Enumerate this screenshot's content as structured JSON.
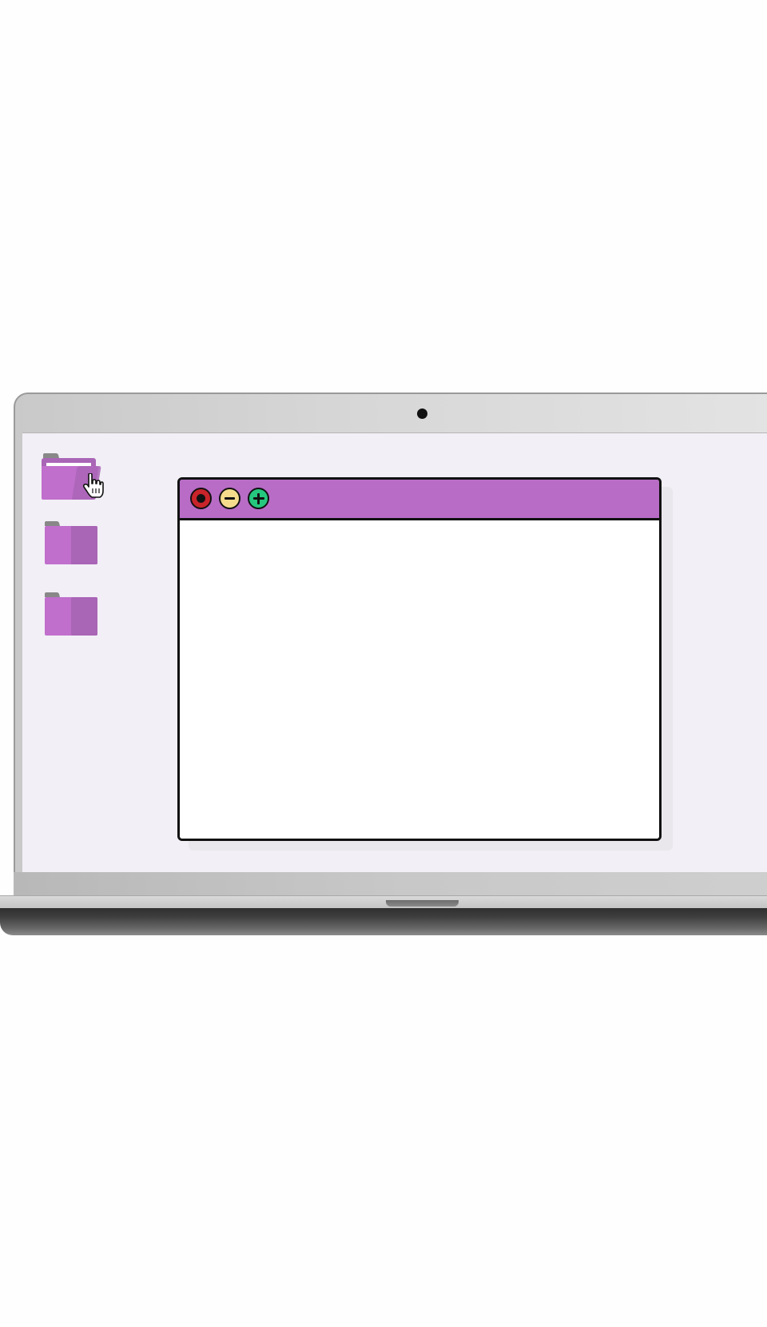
{
  "desktop": {
    "icons": [
      {
        "name": "folder-open-icon",
        "state": "hovered"
      },
      {
        "name": "folder-icon",
        "state": "default"
      },
      {
        "name": "folder-icon",
        "state": "default"
      }
    ],
    "cursor": "hand-pointer-icon"
  },
  "window": {
    "titlebar_color": "#b86cc6",
    "buttons": [
      {
        "name": "close-button",
        "icon": "close-icon",
        "color": "#c8242a"
      },
      {
        "name": "minimize-button",
        "icon": "minus-icon",
        "color": "#f4dc8c"
      },
      {
        "name": "maximize-button",
        "icon": "plus-icon",
        "color": "#25c77e"
      }
    ],
    "content": ""
  },
  "colors": {
    "screen_background": "#f2eff6",
    "folder_purple": "#c06fcc",
    "folder_purple_dark": "#a965b6"
  }
}
